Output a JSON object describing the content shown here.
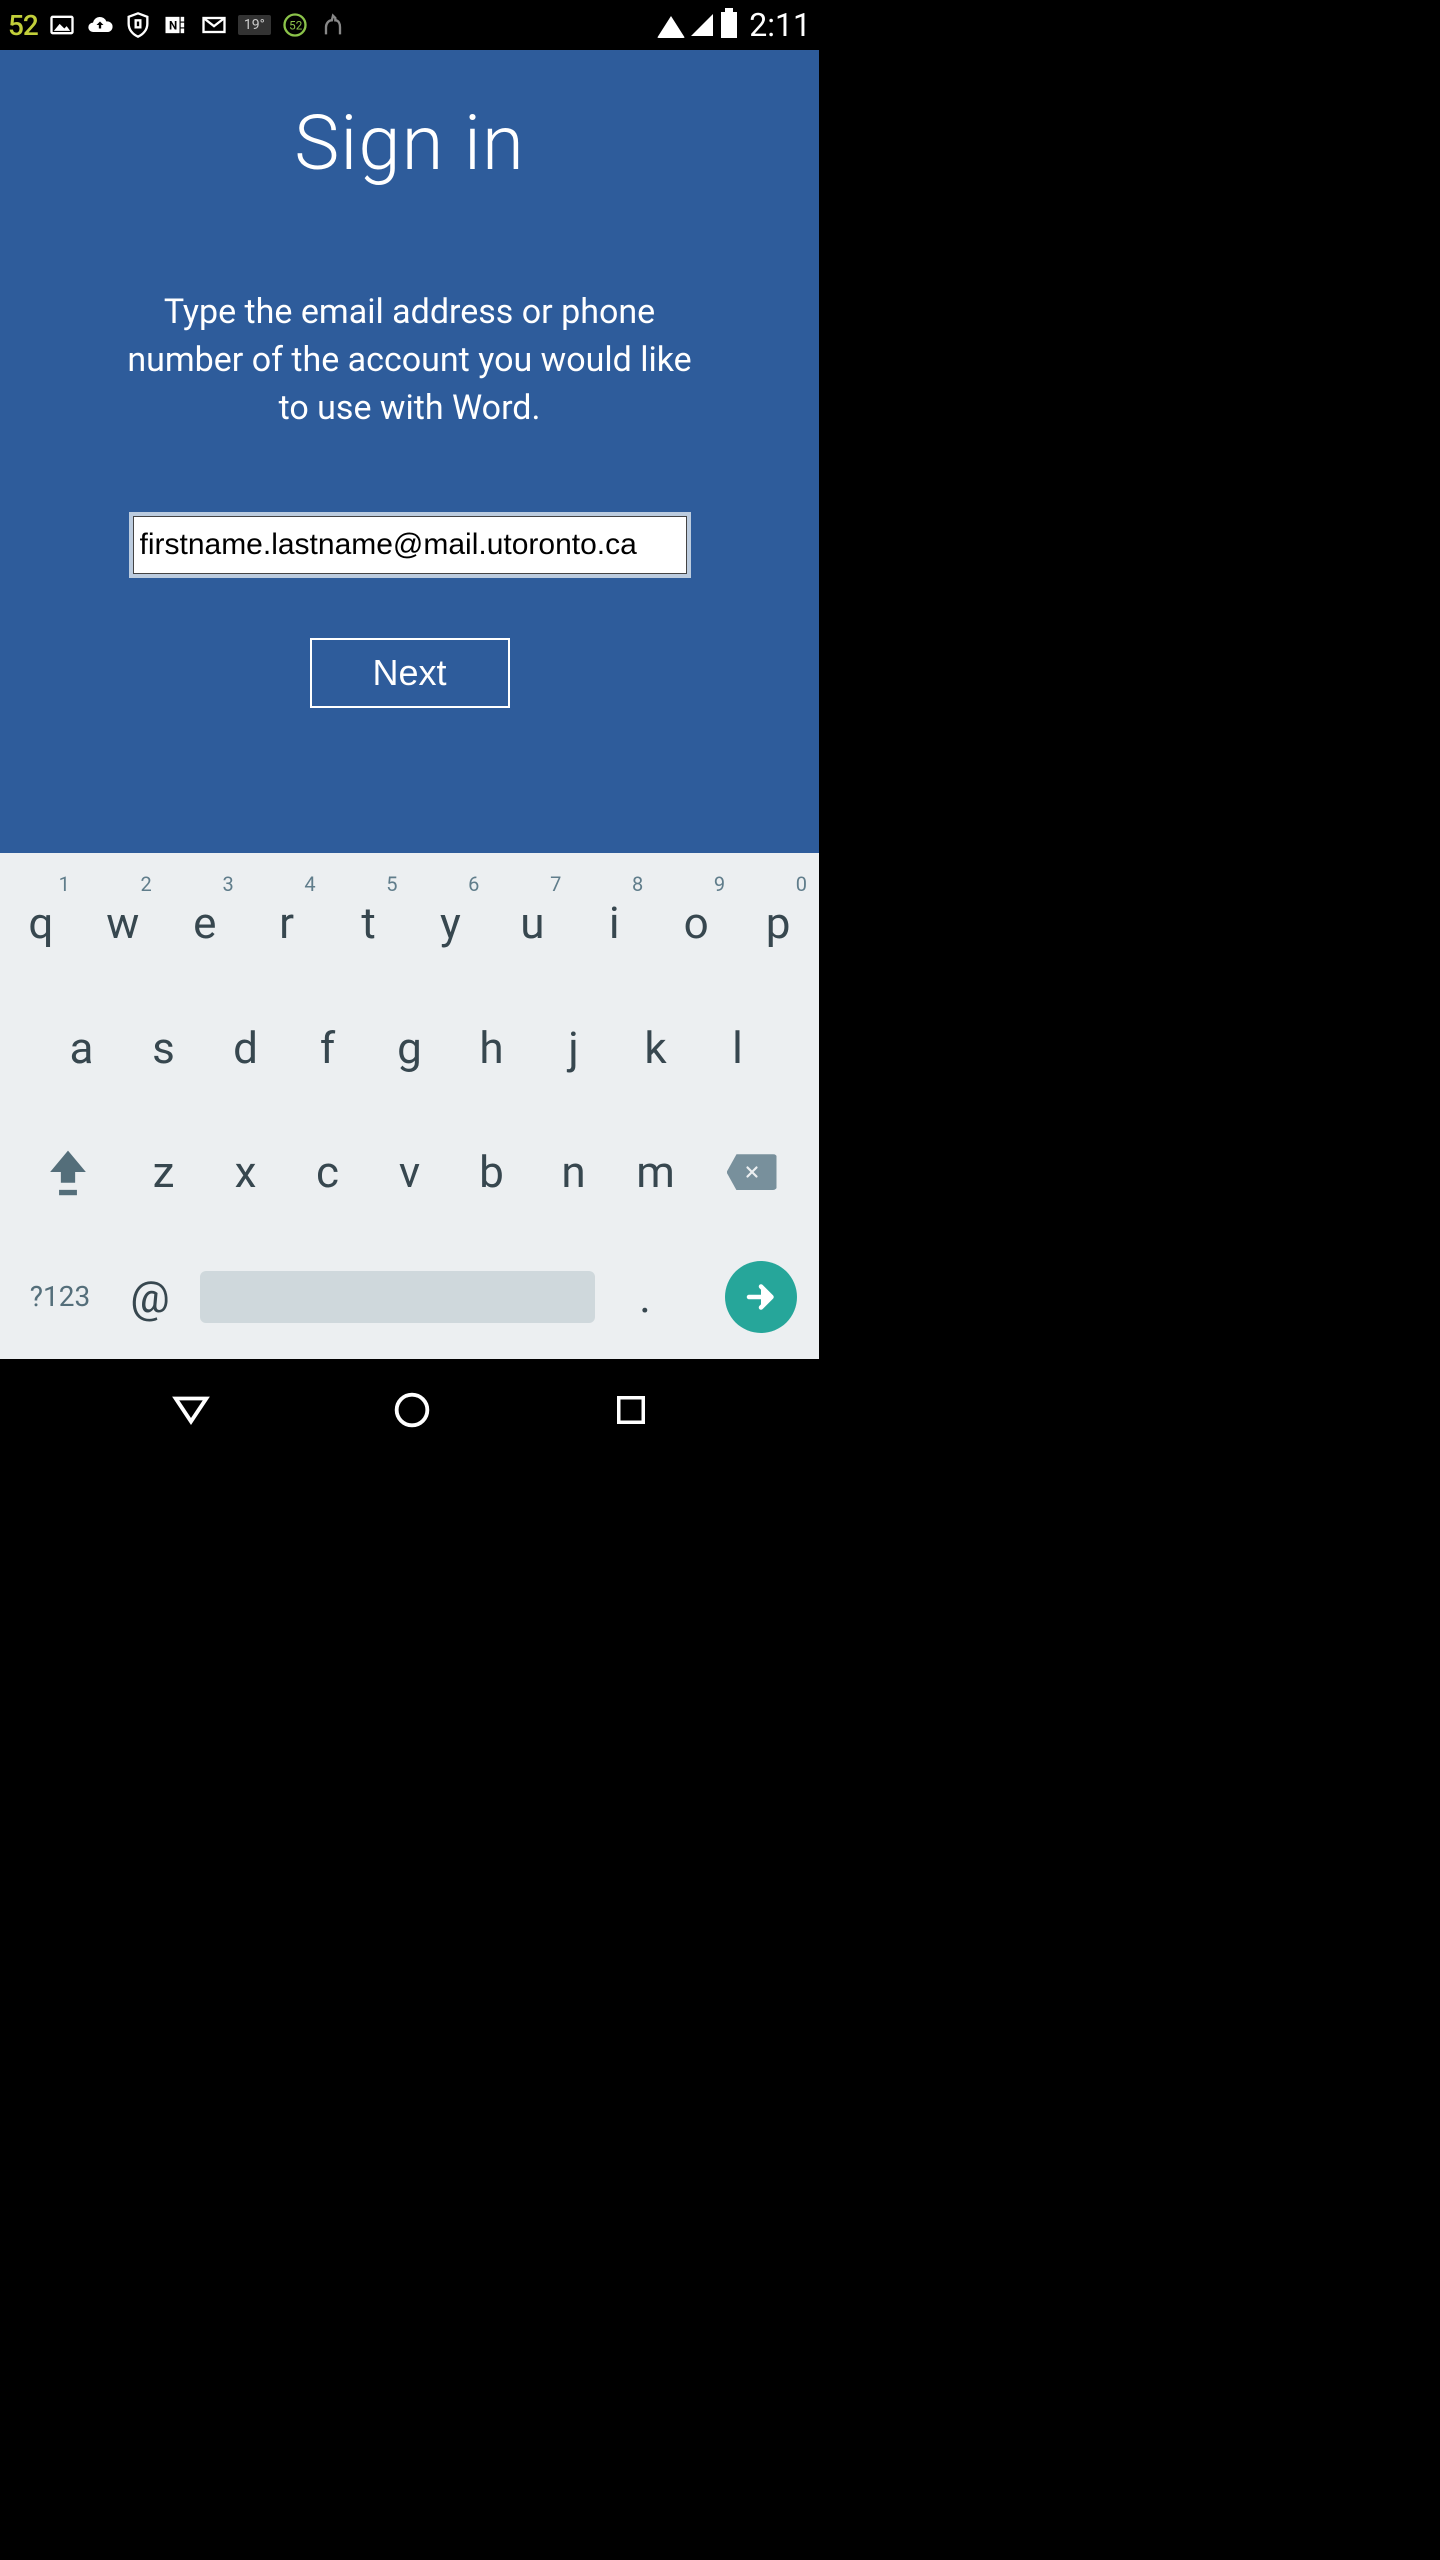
{
  "status": {
    "badge": "52",
    "time": "2:11",
    "temp": "19°"
  },
  "signin": {
    "title": "Sign in",
    "instruction": "Type the email address or phone number of the account you would like to use with Word.",
    "email_value": "firstname.lastname@mail.utoronto.ca",
    "next_label": "Next"
  },
  "keyboard": {
    "row1": [
      {
        "k": "q",
        "n": "1"
      },
      {
        "k": "w",
        "n": "2"
      },
      {
        "k": "e",
        "n": "3"
      },
      {
        "k": "r",
        "n": "4"
      },
      {
        "k": "t",
        "n": "5"
      },
      {
        "k": "y",
        "n": "6"
      },
      {
        "k": "u",
        "n": "7"
      },
      {
        "k": "i",
        "n": "8"
      },
      {
        "k": "o",
        "n": "9"
      },
      {
        "k": "p",
        "n": "0"
      }
    ],
    "row2": [
      "a",
      "s",
      "d",
      "f",
      "g",
      "h",
      "j",
      "k",
      "l"
    ],
    "row3": [
      "z",
      "x",
      "c",
      "v",
      "b",
      "n",
      "m"
    ],
    "sym": "?123",
    "at": "@",
    "dot": "."
  }
}
